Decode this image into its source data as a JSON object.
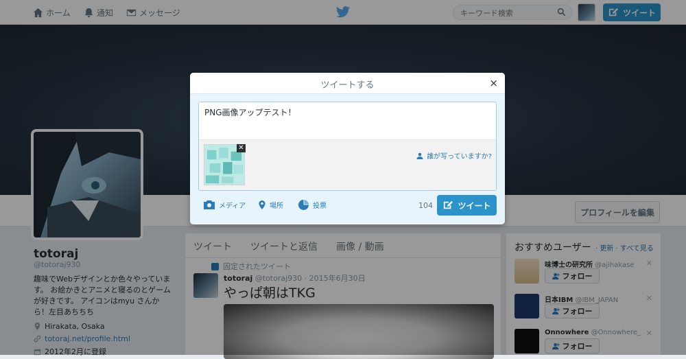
{
  "nav": {
    "home": "ホーム",
    "notifications": "通知",
    "messages": "メッセージ",
    "search_placeholder": "キーワード検索",
    "tweet_button": "ツイート"
  },
  "profile": {
    "display_name": "totoraj",
    "screen_name": "@totoraj930",
    "bio": "趣味でWebデザインとか色々やっています。 お絵かきとアニメと寝るのとゲームが好きです。 アイコンはmyu さんから！左目あちちち",
    "location": "Hirakata, Osaka",
    "url": "totoraj.net/profile.html",
    "joined": "2012年2月に登録",
    "edit_button": "プロフィールを編集"
  },
  "timeline": {
    "tabs": [
      "ツイート",
      "ツイートと返信",
      "画像 / 動画"
    ],
    "pinned_label": "固定されたツイート",
    "tweet": {
      "name": "totoraj",
      "handle": "@totoraj930",
      "date": "2015年6月30日",
      "text": "やっぱ朝はTKG"
    }
  },
  "who_to_follow": {
    "title": "おすすめユーザー",
    "links": "· 更新 · すべて見る",
    "follow_label": "フォロー",
    "users": [
      {
        "name": "味博士の研究所",
        "handle": "@ajihakase"
      },
      {
        "name": "日本IBM",
        "handle": "@IBM_JAPAN"
      },
      {
        "name": "Onnowhere",
        "handle": "@Onnowhere_"
      }
    ]
  },
  "modal": {
    "title": "ツイートする",
    "close": "×",
    "composer_text": "PNG画像アップテスト！",
    "thumb_remove": "✕",
    "tag_people": "誰が写っていますか?",
    "tools": {
      "media": "メディア",
      "location": "場所",
      "poll": "投票"
    },
    "char_count": "104",
    "tweet_button": "ツイート"
  },
  "colors": {
    "accent": "#2b93c9",
    "link": "#2b7bb9",
    "modal_bg": "#e8f4fb"
  }
}
